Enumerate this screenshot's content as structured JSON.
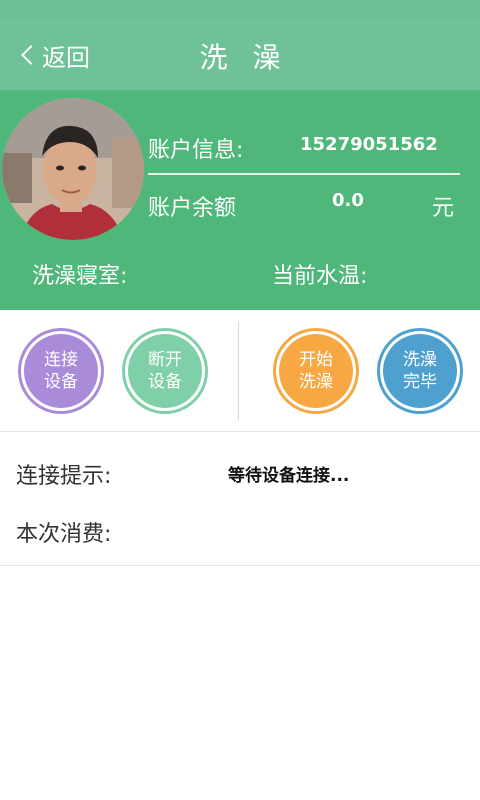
{
  "header": {
    "back_label": "返回",
    "title": "洗 澡"
  },
  "account": {
    "info_label": "账户信息:",
    "info_value": "15279051562",
    "balance_label": "账户余额",
    "balance_value": "0.0",
    "currency_unit": "元",
    "dorm_label": "洗澡寝室:",
    "temp_label": "当前水温:"
  },
  "actions": {
    "connect": {
      "line1": "连接",
      "line2": "设备"
    },
    "disconnect": {
      "line1": "断开",
      "line2": "设备"
    },
    "start": {
      "line1": "开始",
      "line2": "洗澡"
    },
    "finish": {
      "line1": "洗澡",
      "line2": "完毕"
    }
  },
  "status": {
    "hint_label": "连接提示:",
    "hint_value": "等待设备连接...",
    "cost_label": "本次消费:"
  },
  "colors": {
    "titlebar": "#6fc198",
    "profile_bg": "#4fb779",
    "connect": "#a98bd9",
    "disconnect": "#7fcfa8",
    "start": "#f7a843",
    "finish": "#4ea1cf"
  }
}
